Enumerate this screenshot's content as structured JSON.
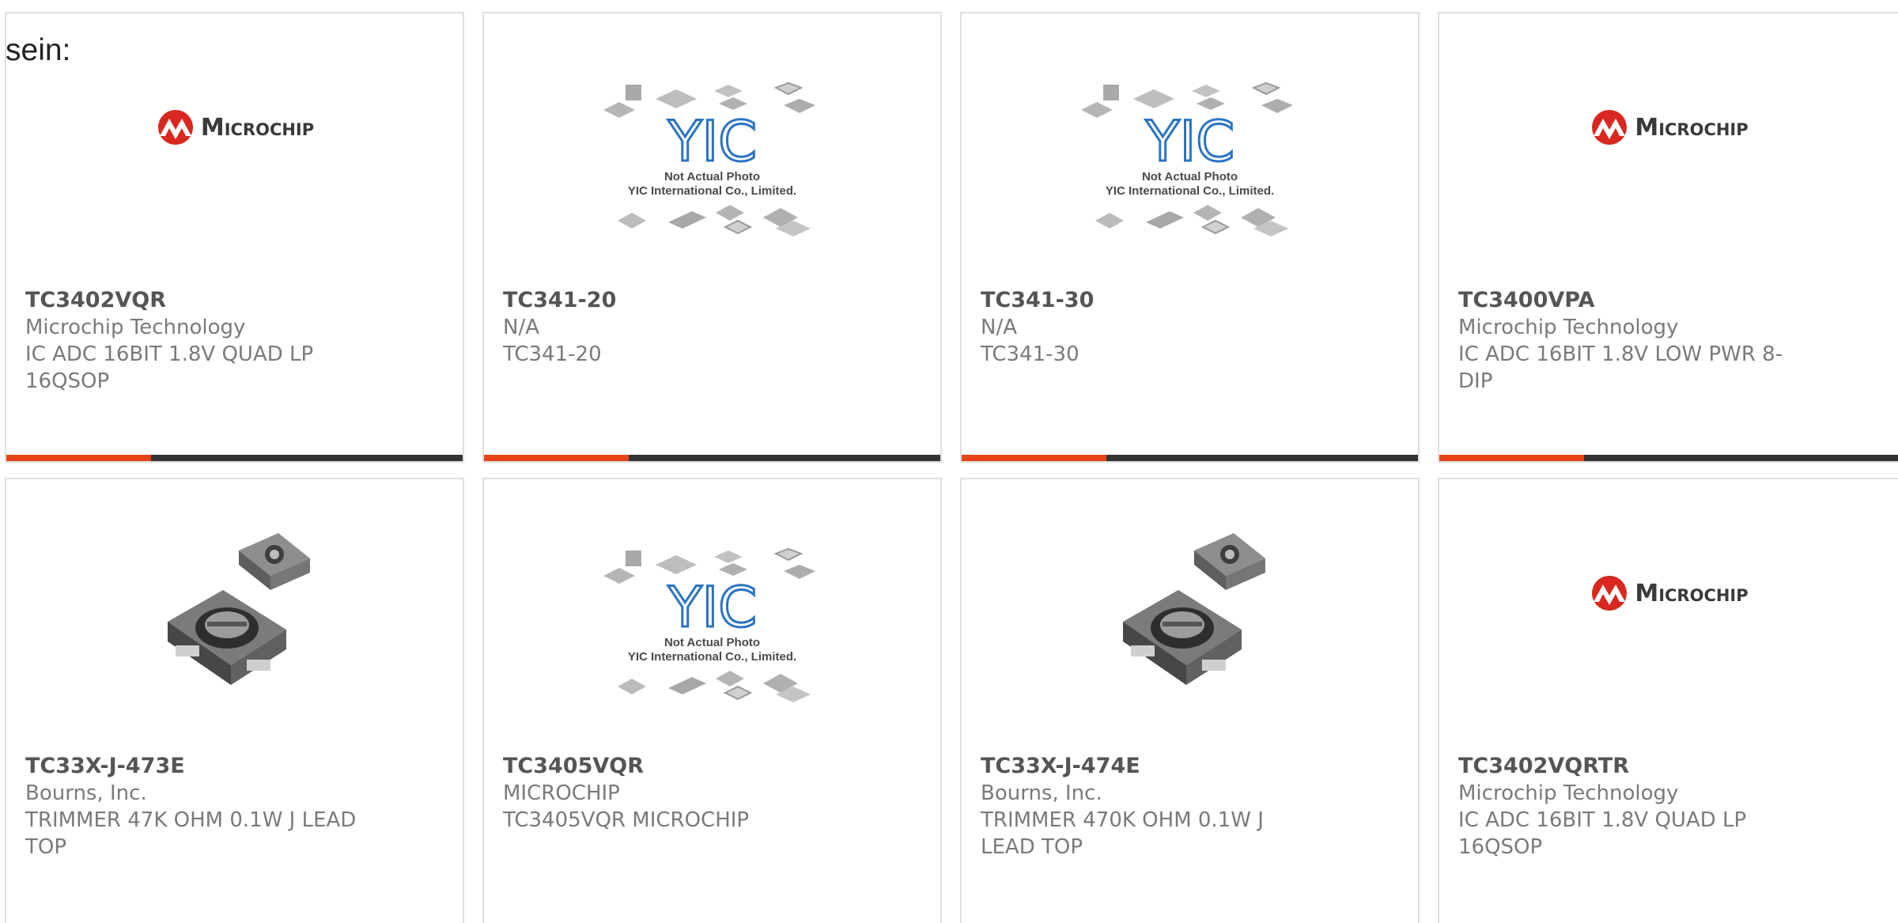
{
  "lead_text": "sein:",
  "colors": {
    "accent": "#e8441a",
    "bar": "#333333",
    "card_border": "#dedede",
    "logo_red": "#d9281f"
  },
  "cards": [
    {
      "part": "TC3402VQR",
      "maker": "Microchip Technology",
      "desc": "IC ADC 16BIT 1.8V QUAD LP 16QSOP",
      "image": "microchip-logo",
      "logo_text": "Microchip"
    },
    {
      "part": "TC341-20",
      "maker": "N/A",
      "desc": "TC341-20",
      "image": "yic-placeholder",
      "photo_note_1": "Not Actual Photo",
      "photo_note_2": "YIC International Co., Limited."
    },
    {
      "part": "TC341-30",
      "maker": "N/A",
      "desc": "TC341-30",
      "image": "yic-placeholder",
      "photo_note_1": "Not Actual Photo",
      "photo_note_2": "YIC International Co., Limited."
    },
    {
      "part": "TC3400VPA",
      "maker": "Microchip Technology",
      "desc": "IC ADC 16BIT 1.8V LOW PWR 8-DIP",
      "image": "microchip-logo",
      "logo_text": "Microchip"
    },
    {
      "part": "TC33X-J-473E",
      "maker": "Bourns, Inc.",
      "desc": "TRIMMER 47K OHM 0.1W J LEAD TOP",
      "image": "trimmer-photo"
    },
    {
      "part": "TC3405VQR",
      "maker": "MICROCHIP",
      "desc": "TC3405VQR MICROCHIP",
      "image": "yic-placeholder",
      "photo_note_1": "Not Actual Photo",
      "photo_note_2": "YIC International Co., Limited."
    },
    {
      "part": "TC33X-J-474E",
      "maker": "Bourns, Inc.",
      "desc": "TRIMMER 470K OHM 0.1W J LEAD TOP",
      "image": "trimmer-photo"
    },
    {
      "part": "TC3402VQRTR",
      "maker": "Microchip Technology",
      "desc": "IC ADC 16BIT 1.8V QUAD LP 16QSOP",
      "image": "microchip-logo",
      "logo_text": "Microchip"
    }
  ]
}
